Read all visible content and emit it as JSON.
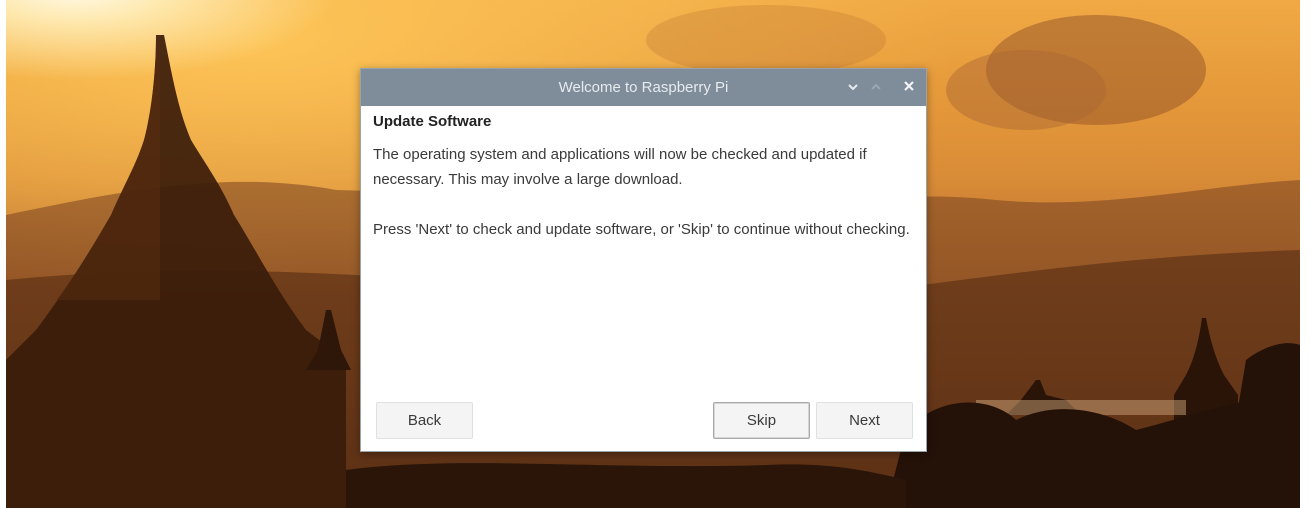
{
  "window": {
    "title": "Welcome to Raspberry Pi",
    "controls": {
      "minimize_icon": "chevron-down-icon",
      "maximize_icon": "chevron-up-icon",
      "close_icon": "close-icon"
    }
  },
  "page": {
    "heading": "Update Software",
    "paragraph_1": "The operating system and applications will now be checked and updated if necessary. This may involve a large download.",
    "paragraph_2": "Press 'Next' to check and update software, or 'Skip' to continue without checking."
  },
  "buttons": {
    "back": "Back",
    "skip": "Skip",
    "next": "Next"
  },
  "colors": {
    "titlebar": "#7f8c99",
    "title_text": "#e6ebef",
    "dialog_bg": "#ffffff"
  }
}
